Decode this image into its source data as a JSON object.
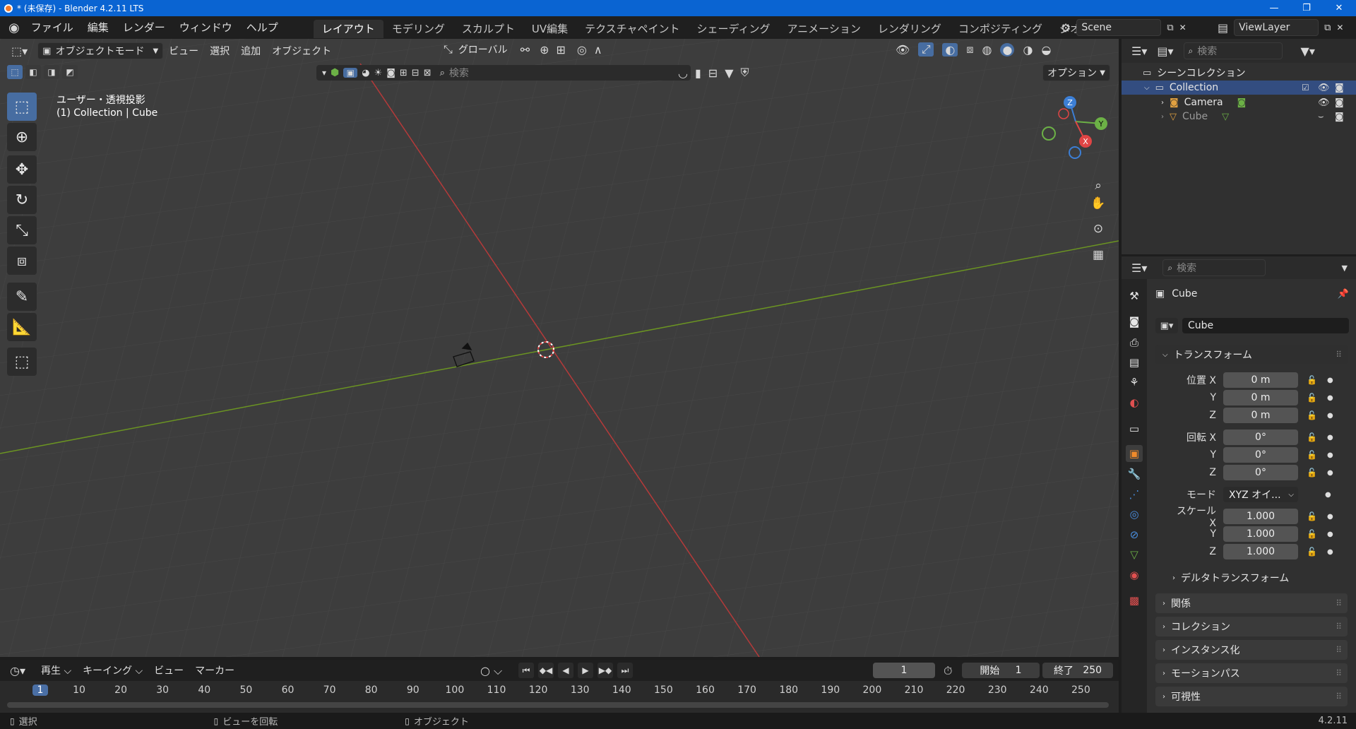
{
  "window": {
    "title": "* (未保存) - Blender 4.2.11 LTS"
  },
  "menu": {
    "items": [
      "ファイル",
      "編集",
      "レンダー",
      "ウィンドウ",
      "ヘルプ"
    ]
  },
  "workspaces": {
    "tabs": [
      "レイアウト",
      "モデリング",
      "スカルプト",
      "UV編集",
      "テクスチャペイント",
      "シェーディング",
      "アニメーション",
      "レンダリング",
      "コンポジティング",
      "ジオメトリ"
    ],
    "active": "レイアウト"
  },
  "scene": {
    "name": "Scene",
    "view_layer": "ViewLayer"
  },
  "viewport_header": {
    "mode": "オブジェクトモード",
    "view": "ビュー",
    "select": "選択",
    "add": "追加",
    "object": "オブジェクト",
    "transform_orientation": "グローバル",
    "search_placeholder": "検索",
    "options": "オプション"
  },
  "viewport": {
    "overlay_line1": "ユーザー・透視投影",
    "overlay_line2": "(1) Collection | Cube",
    "gizmo": {
      "x": "X",
      "y": "Y",
      "z": "Z"
    }
  },
  "outliner": {
    "search_placeholder": "検索",
    "scene_collection": "シーンコレクション",
    "items": [
      {
        "name": "Collection"
      },
      {
        "name": "Camera"
      },
      {
        "name": "Cube"
      }
    ]
  },
  "properties": {
    "search_placeholder": "検索",
    "object_name": "Cube",
    "data_name": "Cube",
    "transform_header": "トランスフォーム",
    "location": {
      "label": "位置",
      "x": "0 m",
      "y": "0 m",
      "z": "0 m"
    },
    "rotation": {
      "label": "回転",
      "x": "0°",
      "y": "0°",
      "z": "0°"
    },
    "mode": {
      "label": "モード",
      "value": "XYZ オイ..."
    },
    "scale": {
      "label": "スケール",
      "x": "1.000",
      "y": "1.000",
      "z": "1.000"
    },
    "axis_labels": {
      "x": "X",
      "y": "Y",
      "z": "Z"
    },
    "delta": "デルタトランスフォーム",
    "panels": [
      "関係",
      "コレクション",
      "インスタンス化",
      "モーションパス",
      "可視性"
    ]
  },
  "timeline": {
    "playback": "再生",
    "keying": "キーイング",
    "view": "ビュー",
    "marker": "マーカー",
    "current_frame": "1",
    "start_label": "開始",
    "start": "1",
    "end_label": "終了",
    "end": "250",
    "ticks": [
      "1",
      "10",
      "20",
      "30",
      "40",
      "50",
      "60",
      "70",
      "80",
      "90",
      "100",
      "110",
      "120",
      "130",
      "140",
      "150",
      "160",
      "170",
      "180",
      "190",
      "200",
      "210",
      "220",
      "230",
      "240",
      "250"
    ]
  },
  "status": {
    "select": "選択",
    "rotate": "ビューを回転",
    "object": "オブジェクト",
    "version": "4.2.11"
  }
}
